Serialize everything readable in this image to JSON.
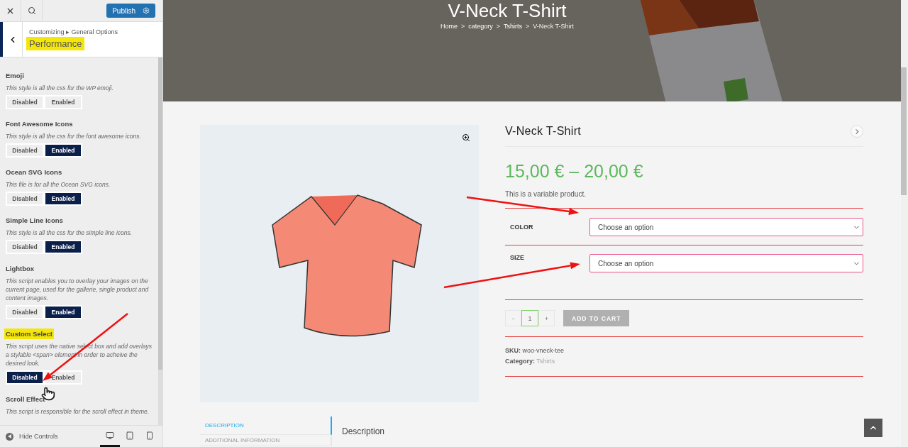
{
  "sidebar": {
    "publish_button": "Publish",
    "breadcrumb": "Customizing ▸ General Options",
    "section_title": "Performance",
    "section_title_highlighted": true,
    "options": [
      {
        "title": "Emoji",
        "description": "This style is all the css for the WP emoji.",
        "highlighted": false,
        "buttons": [
          {
            "label": "Disabled",
            "selected": false
          },
          {
            "label": "Enabled",
            "selected": false
          }
        ]
      },
      {
        "title": "Font Awesome Icons",
        "description": "This style is all the css for the font awesome icons.",
        "highlighted": false,
        "buttons": [
          {
            "label": "Disabled",
            "selected": false
          },
          {
            "label": "Enabled",
            "selected": true
          }
        ]
      },
      {
        "title": "Ocean SVG Icons",
        "description": "This file is for all the Ocean SVG icons.",
        "highlighted": false,
        "buttons": [
          {
            "label": "Disabled",
            "selected": false
          },
          {
            "label": "Enabled",
            "selected": true
          }
        ]
      },
      {
        "title": "Simple Line Icons",
        "description": "This style is all the css for the simple line icons.",
        "highlighted": false,
        "buttons": [
          {
            "label": "Disabled",
            "selected": false
          },
          {
            "label": "Enabled",
            "selected": true
          }
        ]
      },
      {
        "title": "Lightbox",
        "description": "This script enables you to overlay your images on the current page, used for the gallerie, single product and content images.",
        "highlighted": false,
        "buttons": [
          {
            "label": "Disabled",
            "selected": false
          },
          {
            "label": "Enabled",
            "selected": true
          }
        ]
      },
      {
        "title": "Custom Select",
        "description": "This script uses the native select box and add overlays a stylable <span> element in order to acheive the desired look.",
        "highlighted": true,
        "buttons": [
          {
            "label": "Disabled",
            "selected": true
          },
          {
            "label": "Enabled",
            "selected": false
          }
        ]
      },
      {
        "title": "Scroll Effect",
        "description": "This script is responsible for the scroll effect in theme.",
        "highlighted": false
      }
    ],
    "footer": {
      "hide_controls": "Hide Controls",
      "devices": [
        {
          "kind": "desktop",
          "selected": true
        },
        {
          "kind": "tablet",
          "selected": false
        },
        {
          "kind": "mobile",
          "selected": false
        }
      ]
    }
  },
  "hero": {
    "title": "V-Neck T-Shirt",
    "breadcrumb": [
      {
        "kind": "link",
        "text": "Home"
      },
      {
        "kind": "sep",
        "text": ">"
      },
      {
        "kind": "link",
        "text": "category"
      },
      {
        "kind": "sep",
        "text": ">"
      },
      {
        "kind": "link",
        "text": "Tshirts"
      },
      {
        "kind": "sep",
        "text": ">"
      },
      {
        "kind": "current",
        "text": "V-Neck T-Shirt"
      }
    ]
  },
  "product": {
    "title": "V-Neck T-Shirt",
    "price": "15,00 € – 20,00 €",
    "short_description": "This is a variable product.",
    "attributes": [
      {
        "label": "COLOR",
        "value": "Choose an option"
      },
      {
        "label": "SIZE",
        "value": "Choose an option"
      }
    ],
    "quantity": {
      "minus": "-",
      "value": "1",
      "plus": "+"
    },
    "add_to_cart": {
      "label": "ADD TO CART",
      "disabled": true
    },
    "meta": [
      {
        "label": "SKU:",
        "value": "woo-vneck-tee",
        "kind": "text"
      },
      {
        "label": "Category:",
        "value": "Tshirts",
        "kind": "link"
      }
    ],
    "tabs": [
      {
        "label": "DESCRIPTION",
        "selected": true
      },
      {
        "label": "ADDITIONAL INFORMATION",
        "selected": false
      }
    ],
    "panel_title": "Description"
  }
}
